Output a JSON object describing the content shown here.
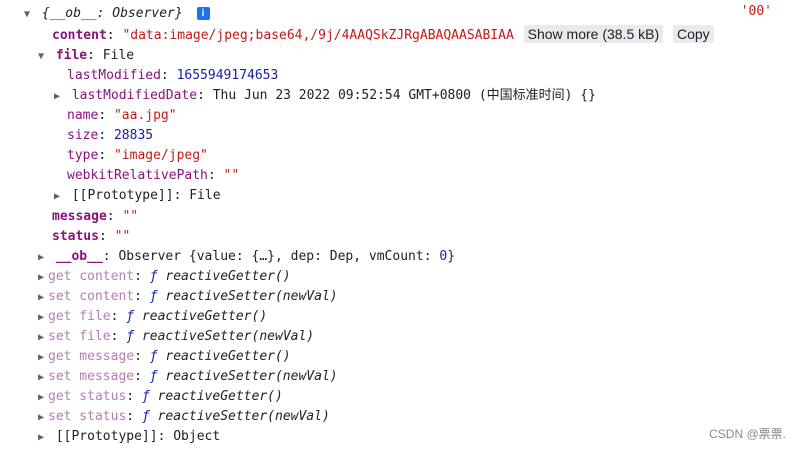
{
  "header": {
    "label": "{__ob__: Observer}",
    "info": "i",
    "tag": "'00'"
  },
  "content": {
    "key": "content",
    "value": "\"data:image/jpeg;base64,/9j/4AAQSkZJRgABAQAASABIAA",
    "show_more": "Show more (38.5 kB)",
    "copy": "Copy"
  },
  "file": {
    "key": "file",
    "type_label": "File",
    "lastModified_key": "lastModified",
    "lastModified": "1655949174653",
    "lastModifiedDate_key": "lastModifiedDate",
    "lastModifiedDate": "Thu Jun 23 2022 09:52:54 GMT+0800 (中国标准时间) {}",
    "name_key": "name",
    "name": "\"aa.jpg\"",
    "size_key": "size",
    "size": "28835",
    "type_key": "type",
    "type": "\"image/jpeg\"",
    "wrp_key": "webkitRelativePath",
    "wrp": "\"\"",
    "proto_key": "[[Prototype]]",
    "proto": "File"
  },
  "message": {
    "key": "message",
    "value": "\"\""
  },
  "status": {
    "key": "status",
    "value": "\"\""
  },
  "ob": {
    "key": "__ob__",
    "pre": "Observer {value: {…}, dep: Dep, vmCount: ",
    "count": "0",
    "post": "}"
  },
  "accessors": [
    {
      "key": "get content",
      "fn": "reactiveGetter()"
    },
    {
      "key": "set content",
      "fn": "reactiveSetter(newVal)"
    },
    {
      "key": "get file",
      "fn": "reactiveGetter()"
    },
    {
      "key": "set file",
      "fn": "reactiveSetter(newVal)"
    },
    {
      "key": "get message",
      "fn": "reactiveGetter()"
    },
    {
      "key": "set message",
      "fn": "reactiveSetter(newVal)"
    },
    {
      "key": "get status",
      "fn": "reactiveGetter()"
    },
    {
      "key": "set status",
      "fn": "reactiveSetter(newVal)"
    }
  ],
  "f_symbol": "ƒ",
  "proto": {
    "key": "[[Prototype]]",
    "value": "Object"
  },
  "watermark": "CSDN @票票."
}
